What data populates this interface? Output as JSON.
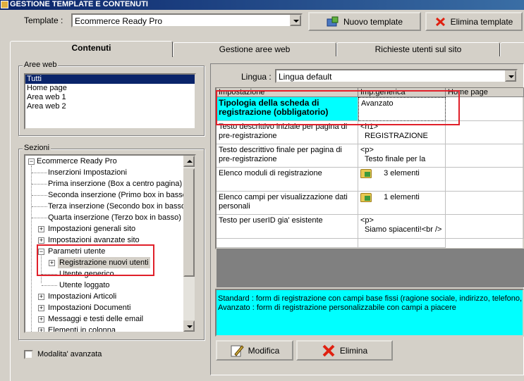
{
  "window": {
    "title": "GESTIONE TEMPLATE E CONTENUTI"
  },
  "toolbar": {
    "template_label": "Template :",
    "template_value": "Ecommerce Ready Pro",
    "new_template": "Nuovo template",
    "delete_template": "Elimina template"
  },
  "tabs": [
    "Contenuti",
    "Gestione aree web",
    "Richieste utenti sul sito"
  ],
  "aree_web": {
    "label": "Aree web",
    "items": [
      "Tutti",
      "Home page",
      "Area web 1",
      "Area web 2"
    ]
  },
  "sezioni": {
    "label": "Sezioni",
    "items": [
      "Ecommerce Ready Pro",
      "Inserzioni Impostazioni",
      "Prima inserzione (Box a centro pagina)",
      "Seconda inserzione (Primo box in basso)",
      "Terza inserzione (Secondo box in basso)",
      "Quarta inserzione (Terzo box in basso)",
      "Impostazioni generali sito",
      "Impostazioni avanzate sito",
      "Parametri utente",
      "Registrazione nuovi utenti",
      "Utente generico",
      "Utente loggato",
      "Impostazioni Articoli",
      "Impostazioni Documenti",
      "Messaggi e testi delle email",
      "Elementi in colonna"
    ]
  },
  "advanced_mode": "Modalita' avanzata",
  "lingua": {
    "label": "Lingua :",
    "value": "Lingua default"
  },
  "grid": {
    "headers": [
      "Impostazione",
      "Imp.generica",
      "Home page"
    ],
    "rows": [
      {
        "setting": "Tipologia della scheda di registrazione (obbligatorio)",
        "generic": "Avanzato"
      },
      {
        "setting": "Testo descrittivo iniziale per pagina di pre-registrazione",
        "generic_line1": "<h1>",
        "generic_line2": "REGISTRAZIONE"
      },
      {
        "setting": "Testo descrittivo finale per pagina di pre-registrazione",
        "generic_line1": "<p>",
        "generic_line2": "Testo finale per la"
      },
      {
        "setting": "Elenco moduli di registrazione",
        "generic": "3 elementi"
      },
      {
        "setting": "Elenco campi per visualizzazione dati personali",
        "generic": "1 elementi"
      },
      {
        "setting": "Testo per userID gia' esistente",
        "generic_line1": "<p>",
        "generic_line2": "Siamo spiacenti!<br />"
      }
    ]
  },
  "description": {
    "line1": "Standard : form di registrazione con campi base fissi (ragione sociale, indirizzo, telefono, f",
    "line2": "Avanzato : form di registrazione personalizzabile con campi a piacere"
  },
  "actions": {
    "edit": "Modifica",
    "delete": "Elimina"
  },
  "colors": {
    "highlight": "#00ffff",
    "selection": "#0a246a",
    "annotation": "#e0202a"
  }
}
